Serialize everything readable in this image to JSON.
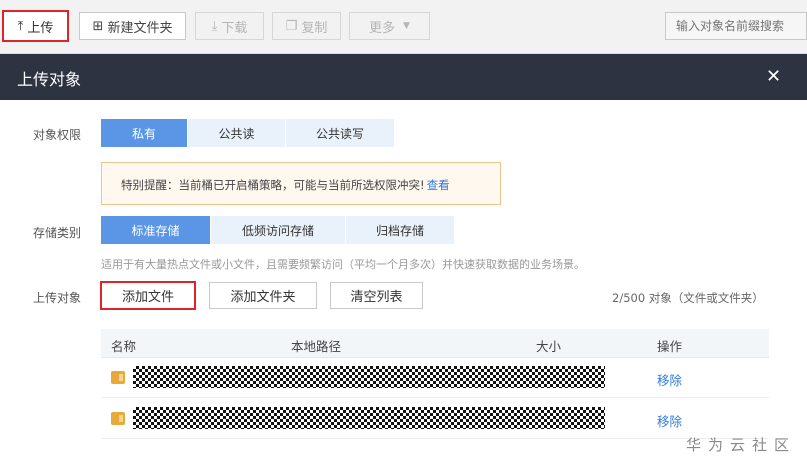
{
  "toolbar": {
    "upload_label": "上传",
    "new_folder_label": "新建文件夹",
    "download_label": "下载",
    "copy_label": "复制",
    "more_label": "更多",
    "search_placeholder": "输入对象名前缀搜索"
  },
  "dialog": {
    "title": "上传对象",
    "close_glyph": "✕",
    "permission": {
      "label": "对象权限",
      "options": [
        "私有",
        "公共读",
        "公共读写"
      ],
      "selected": "私有"
    },
    "notice": {
      "text": "特别提醒：当前桶已开启桶策略，可能与当前所选权限冲突!",
      "link": "查看"
    },
    "storage": {
      "label": "存储类别",
      "options": [
        "标准存储",
        "低频访问存储",
        "归档存储"
      ],
      "selected": "标准存储",
      "hint": "适用于有大量热点文件或小文件，且需要频繁访问（平均一个月多次）并快速获取数据的业务场景。"
    },
    "upload": {
      "label": "上传对象",
      "add_file_label": "添加文件",
      "add_folder_label": "添加文件夹",
      "clear_label": "清空列表",
      "count_text": "2/500 对象（文件或文件夹）"
    },
    "table": {
      "columns": [
        "名称",
        "本地路径",
        "大小",
        "操作"
      ],
      "rows": [
        {
          "action": "移除"
        },
        {
          "action": "移除"
        }
      ]
    }
  },
  "watermark": "华为云社区",
  "colors": {
    "accent": "#5b96e6",
    "header_bg": "#2d3340",
    "highlight_border": "#d9252b",
    "link": "#2f7ad8"
  }
}
